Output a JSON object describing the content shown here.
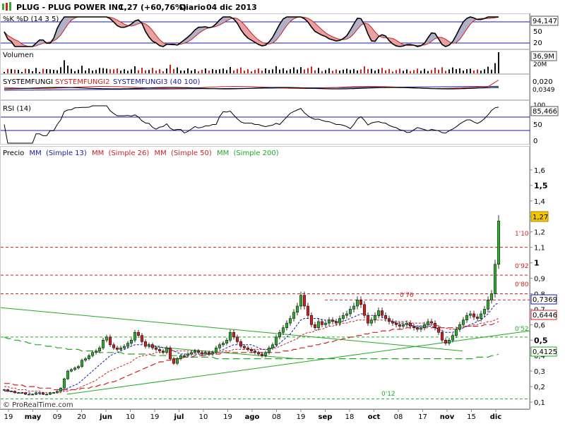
{
  "header": {
    "ticker": "PLUG - PLUG POWER INC.",
    "price_change": "1,27 (+60,76%)",
    "period": "Diario",
    "date": "04 dic 2013"
  },
  "stoch_panel": {
    "label": "%K %D (14 3 5)",
    "value_label": "94,147",
    "ticks": [
      "80",
      "50",
      "20"
    ]
  },
  "volume_panel": {
    "label": "Volumen",
    "value_label": "36,9M",
    "tick": "20M"
  },
  "system_panel": {
    "label_a": "SYSTEMFUNGI",
    "label_b": "SYSTEMFUNGI2",
    "label_c": "SYSTEMFUNGI3 (40 100)",
    "value_label": "0,020",
    "value_label2": "0,0349"
  },
  "rsi_panel": {
    "label": "RSI (14)",
    "value_label": "85,466",
    "ticks": [
      "50",
      "0"
    ],
    "top_tick": "100"
  },
  "price_panel": {
    "label_prefix": "Precio",
    "ma_labels": [
      {
        "prefix": "MM",
        "name": "(Simple 13)",
        "color": "#1a1aa6"
      },
      {
        "prefix": "MM",
        "name": "(Simple 26)",
        "color": "#cc2222"
      },
      {
        "prefix": "MM",
        "name": "(Simple 50)",
        "color": "#cc2222"
      },
      {
        "prefix": "MM",
        "name": "(Simple 200)",
        "color": "#22aa22"
      }
    ],
    "level_labels": [
      "1'10",
      "0'92",
      "0'80",
      "0'76",
      "0'52",
      "0'12"
    ],
    "price_boxes": {
      "last": "1,27",
      "ma13": "0,7369",
      "ma26": "0,6446",
      "ma200": "0,4125"
    }
  },
  "x_axis_labels": [
    "19",
    "may",
    "09",
    "20",
    "jun",
    "10",
    "19",
    "jul",
    "10",
    "19",
    "ago",
    "08",
    "19",
    "sep",
    "18",
    "oct",
    "08",
    "17",
    "nov",
    "15",
    "dic"
  ],
  "watermark": "© ProRealTime.com",
  "chart_data": {
    "type": "candlestick",
    "title": "PLUG - PLUG POWER INC.",
    "y_ticks": [
      "1,6",
      "1,5",
      "1,4",
      "1,3",
      "1,2",
      "1,1",
      "1",
      "0,9",
      "0,8",
      "0,7",
      "0,6",
      "0,5",
      "0,4",
      "0,3",
      "0,2",
      "0,1"
    ],
    "ylim": [
      0.1,
      1.65
    ],
    "levels": [
      1.1,
      0.92,
      0.8,
      0.76,
      0.52,
      0.12
    ],
    "last_close": 1.27,
    "close_series": [
      0.18,
      0.17,
      0.17,
      0.16,
      0.16,
      0.16,
      0.15,
      0.15,
      0.15,
      0.16,
      0.16,
      0.15,
      0.15,
      0.16,
      0.16,
      0.17,
      0.19,
      0.25,
      0.3,
      0.31,
      0.32,
      0.33,
      0.37,
      0.38,
      0.4,
      0.42,
      0.43,
      0.45,
      0.5,
      0.52,
      0.47,
      0.45,
      0.44,
      0.45,
      0.46,
      0.48,
      0.5,
      0.55,
      0.53,
      0.49,
      0.46,
      0.47,
      0.45,
      0.44,
      0.43,
      0.42,
      0.45,
      0.38,
      0.35,
      0.38,
      0.4,
      0.4,
      0.41,
      0.42,
      0.43,
      0.42,
      0.41,
      0.42,
      0.41,
      0.42,
      0.45,
      0.47,
      0.48,
      0.5,
      0.55,
      0.52,
      0.49,
      0.46,
      0.45,
      0.44,
      0.43,
      0.42,
      0.41,
      0.4,
      0.42,
      0.45,
      0.47,
      0.52,
      0.55,
      0.58,
      0.61,
      0.64,
      0.68,
      0.72,
      0.79,
      0.72,
      0.66,
      0.6,
      0.58,
      0.62,
      0.6,
      0.61,
      0.63,
      0.62,
      0.61,
      0.64,
      0.66,
      0.67,
      0.7,
      0.72,
      0.76,
      0.73,
      0.66,
      0.61,
      0.63,
      0.66,
      0.69,
      0.66,
      0.64,
      0.62,
      0.61,
      0.6,
      0.59,
      0.6,
      0.61,
      0.59,
      0.58,
      0.57,
      0.58,
      0.6,
      0.62,
      0.61,
      0.58,
      0.55,
      0.5,
      0.48,
      0.5,
      0.53,
      0.57,
      0.6,
      0.63,
      0.66,
      0.67,
      0.65,
      0.64,
      0.67,
      0.7,
      0.76,
      0.8,
      0.99,
      1.27
    ],
    "ma13_series": [
      0.17,
      0.17,
      0.17,
      0.16,
      0.16,
      0.16,
      0.16,
      0.16,
      0.15,
      0.15,
      0.15,
      0.15,
      0.15,
      0.15,
      0.16,
      0.16,
      0.17,
      0.18,
      0.19,
      0.2,
      0.21,
      0.22,
      0.24,
      0.26,
      0.28,
      0.3,
      0.32,
      0.34,
      0.36,
      0.38,
      0.4,
      0.41,
      0.42,
      0.43,
      0.44,
      0.45,
      0.46,
      0.47,
      0.47,
      0.47,
      0.47,
      0.47,
      0.47,
      0.46,
      0.46,
      0.45,
      0.45,
      0.44,
      0.43,
      0.42,
      0.41,
      0.41,
      0.41,
      0.41,
      0.41,
      0.41,
      0.41,
      0.41,
      0.41,
      0.41,
      0.42,
      0.43,
      0.44,
      0.45,
      0.46,
      0.47,
      0.47,
      0.47,
      0.47,
      0.47,
      0.47,
      0.46,
      0.45,
      0.44,
      0.44,
      0.44,
      0.45,
      0.46,
      0.48,
      0.5,
      0.52,
      0.54,
      0.57,
      0.6,
      0.63,
      0.64,
      0.64,
      0.64,
      0.64,
      0.64,
      0.63,
      0.63,
      0.63,
      0.63,
      0.62,
      0.62,
      0.62,
      0.63,
      0.64,
      0.65,
      0.66,
      0.67,
      0.67,
      0.66,
      0.66,
      0.66,
      0.66,
      0.65,
      0.64,
      0.63,
      0.62,
      0.61,
      0.61,
      0.61,
      0.6,
      0.6,
      0.59,
      0.59,
      0.59,
      0.59,
      0.59,
      0.59,
      0.58,
      0.57,
      0.56,
      0.55,
      0.55,
      0.55,
      0.56,
      0.57,
      0.58,
      0.59,
      0.6,
      0.61,
      0.62,
      0.63,
      0.65,
      0.67,
      0.7,
      0.73,
      0.74
    ],
    "ma26_series": [
      0.2,
      0.2,
      0.19,
      0.19,
      0.18,
      0.18,
      0.18,
      0.17,
      0.17,
      0.17,
      0.17,
      0.16,
      0.16,
      0.16,
      0.16,
      0.16,
      0.16,
      0.17,
      0.17,
      0.18,
      0.18,
      0.19,
      0.2,
      0.21,
      0.22,
      0.23,
      0.24,
      0.26,
      0.27,
      0.29,
      0.3,
      0.31,
      0.32,
      0.33,
      0.34,
      0.35,
      0.36,
      0.38,
      0.39,
      0.4,
      0.4,
      0.41,
      0.41,
      0.42,
      0.42,
      0.42,
      0.43,
      0.43,
      0.43,
      0.43,
      0.43,
      0.43,
      0.43,
      0.43,
      0.43,
      0.43,
      0.43,
      0.42,
      0.42,
      0.42,
      0.42,
      0.42,
      0.43,
      0.43,
      0.43,
      0.44,
      0.44,
      0.44,
      0.44,
      0.44,
      0.44,
      0.44,
      0.44,
      0.44,
      0.44,
      0.44,
      0.45,
      0.45,
      0.46,
      0.47,
      0.48,
      0.49,
      0.5,
      0.51,
      0.53,
      0.54,
      0.55,
      0.55,
      0.56,
      0.57,
      0.57,
      0.58,
      0.59,
      0.59,
      0.6,
      0.6,
      0.61,
      0.61,
      0.62,
      0.62,
      0.63,
      0.63,
      0.63,
      0.63,
      0.63,
      0.63,
      0.63,
      0.63,
      0.63,
      0.63,
      0.62,
      0.62,
      0.62,
      0.62,
      0.62,
      0.61,
      0.61,
      0.61,
      0.61,
      0.61,
      0.6,
      0.6,
      0.6,
      0.59,
      0.58,
      0.58,
      0.57,
      0.57,
      0.57,
      0.58,
      0.58,
      0.59,
      0.59,
      0.6,
      0.6,
      0.61,
      0.61,
      0.62,
      0.62,
      0.63,
      0.64
    ],
    "ma50_series": [
      0.22,
      0.22,
      0.22,
      0.21,
      0.21,
      0.21,
      0.2,
      0.2,
      0.2,
      0.2,
      0.19,
      0.19,
      0.19,
      0.19,
      0.18,
      0.18,
      0.18,
      0.18,
      0.18,
      0.18,
      0.18,
      0.18,
      0.19,
      0.19,
      0.19,
      0.2,
      0.2,
      0.21,
      0.21,
      0.22,
      0.23,
      0.23,
      0.24,
      0.25,
      0.26,
      0.27,
      0.28,
      0.29,
      0.3,
      0.31,
      0.32,
      0.33,
      0.34,
      0.35,
      0.36,
      0.36,
      0.37,
      0.37,
      0.38,
      0.38,
      0.38,
      0.39,
      0.39,
      0.39,
      0.4,
      0.4,
      0.4,
      0.4,
      0.41,
      0.41,
      0.41,
      0.41,
      0.42,
      0.42,
      0.42,
      0.42,
      0.42,
      0.42,
      0.42,
      0.42,
      0.42,
      0.42,
      0.42,
      0.42,
      0.42,
      0.42,
      0.42,
      0.42,
      0.42,
      0.43,
      0.43,
      0.43,
      0.44,
      0.44,
      0.45,
      0.45,
      0.46,
      0.46,
      0.47,
      0.47,
      0.48,
      0.48,
      0.49,
      0.49,
      0.5,
      0.5,
      0.51,
      0.51,
      0.52,
      0.52,
      0.53,
      0.53,
      0.54,
      0.54,
      0.55,
      0.55,
      0.55,
      0.56,
      0.56,
      0.56,
      0.57,
      0.57,
      0.57,
      0.57,
      0.58,
      0.58,
      0.58,
      0.58,
      0.58,
      0.58,
      0.58,
      0.58,
      0.58,
      0.58,
      0.58,
      0.58,
      0.58,
      0.58,
      0.58,
      0.58,
      0.59,
      0.59,
      0.59,
      0.59,
      0.59,
      0.59,
      0.6,
      0.6,
      0.6,
      0.61,
      0.62
    ],
    "ma200_series": [
      0.52,
      0.51,
      0.51,
      0.5,
      0.5,
      0.49,
      0.49,
      0.48,
      0.48,
      0.47,
      0.47,
      0.47,
      0.46,
      0.46,
      0.46,
      0.45,
      0.45,
      0.45,
      0.44,
      0.44,
      0.44,
      0.44,
      0.43,
      0.43,
      0.43,
      0.43,
      0.43,
      0.42,
      0.42,
      0.42,
      0.42,
      0.42,
      0.42,
      0.42,
      0.41,
      0.41,
      0.41,
      0.41,
      0.41,
      0.41,
      0.41,
      0.41,
      0.4,
      0.4,
      0.4,
      0.4,
      0.4,
      0.4,
      0.4,
      0.4,
      0.39,
      0.39,
      0.39,
      0.39,
      0.39,
      0.39,
      0.39,
      0.39,
      0.39,
      0.39,
      0.38,
      0.38,
      0.38,
      0.38,
      0.38,
      0.38,
      0.38,
      0.38,
      0.38,
      0.38,
      0.38,
      0.38,
      0.38,
      0.38,
      0.38,
      0.38,
      0.38,
      0.38,
      0.38,
      0.38,
      0.38,
      0.38,
      0.38,
      0.38,
      0.38,
      0.38,
      0.38,
      0.38,
      0.38,
      0.38,
      0.38,
      0.38,
      0.38,
      0.38,
      0.38,
      0.38,
      0.38,
      0.38,
      0.38,
      0.38,
      0.38,
      0.38,
      0.38,
      0.38,
      0.38,
      0.38,
      0.38,
      0.38,
      0.38,
      0.38,
      0.38,
      0.38,
      0.38,
      0.38,
      0.38,
      0.38,
      0.38,
      0.38,
      0.38,
      0.38,
      0.38,
      0.38,
      0.38,
      0.38,
      0.38,
      0.38,
      0.38,
      0.38,
      0.38,
      0.38,
      0.38,
      0.38,
      0.38,
      0.38,
      0.39,
      0.39,
      0.39,
      0.39,
      0.4,
      0.4,
      0.41
    ]
  },
  "colors": {
    "up_candle": "#33aa33",
    "down_candle": "#cc2222",
    "level_line": "#cc2222",
    "trend_line": "#22aa22",
    "panel_line": "#1a1aa6",
    "stoch_fill": "#e8a0a0",
    "stoch_fill2": "#b0b0c8"
  }
}
